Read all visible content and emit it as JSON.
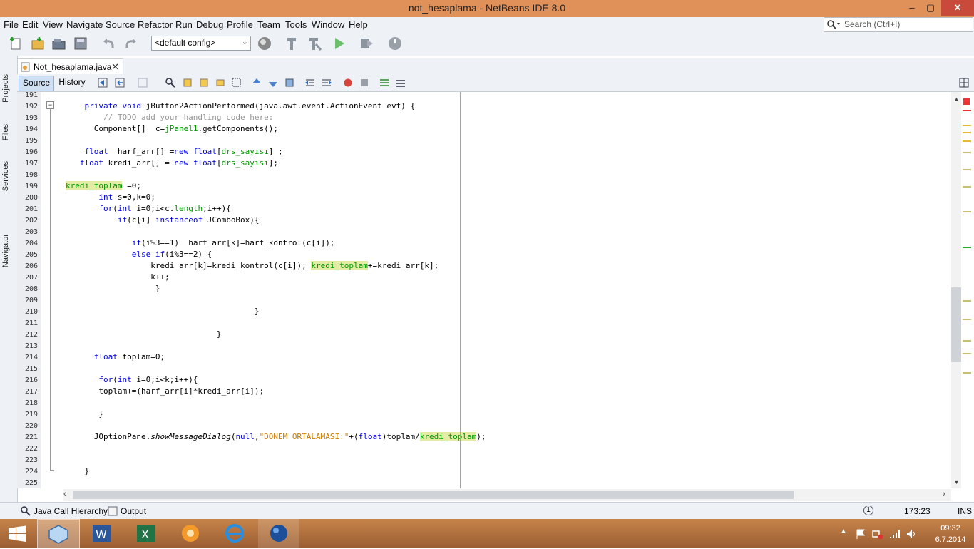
{
  "window": {
    "title": "not_hesaplama - NetBeans IDE 8.0",
    "minimize": "–",
    "maximize": "▢",
    "close": "✕"
  },
  "menu": [
    "File",
    "Edit",
    "View",
    "Navigate",
    "Source",
    "Refactor",
    "Run",
    "Debug",
    "Profile",
    "Team",
    "Tools",
    "Window",
    "Help"
  ],
  "search": {
    "placeholder": "Search (Ctrl+I)"
  },
  "toolbar": {
    "config": "<default config>"
  },
  "side_tabs": [
    "Projects",
    "Files",
    "Services",
    "Navigator"
  ],
  "editor": {
    "file_tab": "Not_hesaplama.java",
    "source_tab": "Source",
    "history_tab": "History",
    "lines": [
      {
        "n": "191",
        "segs": []
      },
      {
        "n": "192",
        "segs": [
          [
            "kw",
            "    private void "
          ],
          [
            "",
            "jButton2ActionPerformed(java.awt.event.ActionEvent "
          ],
          [
            "",
            "evt"
          ],
          [
            "",
            ") {"
          ]
        ]
      },
      {
        "n": "193",
        "segs": [
          [
            "cm",
            "        // TODO add your handling code here:"
          ]
        ]
      },
      {
        "n": "194",
        "segs": [
          [
            "",
            "      Component[]  c="
          ],
          [
            "fld",
            "jPanel1"
          ],
          [
            "",
            ".getComponents();"
          ]
        ]
      },
      {
        "n": "195",
        "segs": []
      },
      {
        "n": "196",
        "segs": [
          [
            "kw",
            "    float"
          ],
          [
            "",
            "  harf_arr[] ="
          ],
          [
            "kw",
            "new float"
          ],
          [
            "",
            "["
          ],
          [
            "fld",
            "drs_sayısı"
          ],
          [
            "",
            "] ;"
          ]
        ]
      },
      {
        "n": "197",
        "segs": [
          [
            "kw",
            "   float"
          ],
          [
            "",
            " kredi_arr[] = "
          ],
          [
            "kw",
            "new float"
          ],
          [
            "",
            "["
          ],
          [
            "fld",
            "drs_sayısı"
          ],
          [
            "",
            "];"
          ]
        ]
      },
      {
        "n": "198",
        "segs": []
      },
      {
        "n": "199",
        "segs": [
          [
            "hl",
            "kredi_toplam"
          ],
          [
            "",
            " =0;"
          ]
        ]
      },
      {
        "n": "200",
        "segs": [
          [
            "kw",
            "       int"
          ],
          [
            "",
            " s=0,k=0;"
          ]
        ]
      },
      {
        "n": "201",
        "segs": [
          [
            "kw",
            "       for"
          ],
          [
            "",
            "("
          ],
          [
            "kw",
            "int"
          ],
          [
            "",
            " i=0;i<c."
          ],
          [
            "fld",
            "length"
          ],
          [
            "",
            ";i++){"
          ]
        ]
      },
      {
        "n": "202",
        "segs": [
          [
            "kw",
            "           if"
          ],
          [
            "",
            "(c[i] "
          ],
          [
            "kw",
            "instanceof"
          ],
          [
            "",
            " JComboBox){"
          ]
        ]
      },
      {
        "n": "203",
        "segs": []
      },
      {
        "n": "204",
        "segs": [
          [
            "kw",
            "              if"
          ],
          [
            "",
            "(i%3==1)  harf_arr[k]=harf_kontrol(c[i]);"
          ]
        ]
      },
      {
        "n": "205",
        "segs": [
          [
            "kw",
            "              else if"
          ],
          [
            "",
            "(i%3==2) {"
          ]
        ]
      },
      {
        "n": "206",
        "segs": [
          [
            "",
            "                  kredi_arr[k]=kredi_kontrol(c[i]); "
          ],
          [
            "hl",
            "kredi_toplam"
          ],
          [
            "",
            "+=kredi_arr[k];"
          ]
        ]
      },
      {
        "n": "207",
        "segs": [
          [
            "",
            "                  k++;"
          ]
        ]
      },
      {
        "n": "208",
        "segs": [
          [
            "",
            "                   }"
          ]
        ]
      },
      {
        "n": "209",
        "segs": []
      },
      {
        "n": "210",
        "segs": [
          [
            "",
            "                                        }"
          ]
        ]
      },
      {
        "n": "211",
        "segs": []
      },
      {
        "n": "212",
        "segs": [
          [
            "",
            "                                }"
          ]
        ]
      },
      {
        "n": "213",
        "segs": []
      },
      {
        "n": "214",
        "segs": [
          [
            "kw",
            "      float"
          ],
          [
            "",
            " toplam=0;"
          ]
        ]
      },
      {
        "n": "215",
        "segs": []
      },
      {
        "n": "216",
        "segs": [
          [
            "kw",
            "       for"
          ],
          [
            "",
            "("
          ],
          [
            "kw",
            "int"
          ],
          [
            "",
            " i=0;i<k;i++){"
          ]
        ]
      },
      {
        "n": "217",
        "segs": [
          [
            "",
            "       toplam+=(harf_arr[i]*kredi_arr[i]);"
          ]
        ]
      },
      {
        "n": "218",
        "segs": []
      },
      {
        "n": "219",
        "segs": [
          [
            "",
            "       }"
          ]
        ]
      },
      {
        "n": "220",
        "segs": []
      },
      {
        "n": "221",
        "segs": [
          [
            "",
            "      JOptionPane."
          ],
          [
            "it",
            "showMessageDialog"
          ],
          [
            "",
            "("
          ],
          [
            "kw",
            "null"
          ],
          [
            "",
            ","
          ],
          [
            "str",
            "\"DONEM ORTALAMASI:\""
          ],
          [
            "",
            "+("
          ],
          [
            "kw",
            "float"
          ],
          [
            "",
            ")toplam/"
          ],
          [
            "hl",
            "kredi_toplam"
          ],
          [
            "",
            ");"
          ]
        ]
      },
      {
        "n": "222",
        "segs": []
      },
      {
        "n": "223",
        "segs": []
      },
      {
        "n": "224",
        "segs": [
          [
            "",
            "    }"
          ]
        ]
      },
      {
        "n": "225",
        "segs": []
      }
    ]
  },
  "bottom": {
    "call_hierarchy": "Java Call Hierarchy",
    "output": "Output",
    "position": "173:23",
    "mode": "INS",
    "notifications": "1"
  },
  "taskbar": {
    "time": "09:32",
    "date": "6.7.2014"
  },
  "colors": {
    "titlebar": "#e0915a",
    "close": "#c74a3a",
    "keyword": "#0000e6",
    "field": "#009900",
    "highlight": "#e4eba5"
  }
}
